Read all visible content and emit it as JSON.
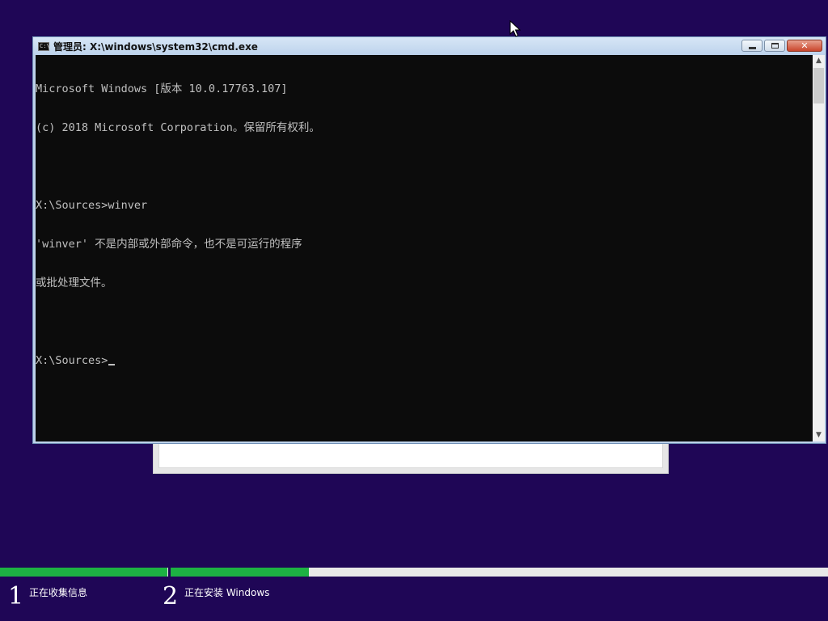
{
  "window": {
    "title": "管理员: X:\\windows\\system32\\cmd.exe",
    "icon": "console-icon",
    "icon_text": "C:\\",
    "buttons": [
      "minimize",
      "maximize",
      "close"
    ],
    "close_glyph": "✕"
  },
  "console": {
    "lines": [
      "Microsoft Windows [版本 10.0.17763.107]",
      "(c) 2018 Microsoft Corporation。保留所有权利。",
      "",
      "X:\\Sources>winver",
      "'winver' 不是内部或外部命令，也不是可运行的程序",
      "或批处理文件。",
      "",
      "X:\\Sources>"
    ],
    "text_color": "#c0c0c0",
    "background_color": "#0c0c0c"
  },
  "scrollbar": {
    "up_arrow": "▲",
    "down_arrow": "▼"
  },
  "setup": {
    "background_color": "#1f0656",
    "progress_color": "#1db143",
    "steps": [
      {
        "number": "1",
        "label": "正在收集信息",
        "progress": 1.0
      },
      {
        "number": "2",
        "label": "正在安装 Windows",
        "progress": 0.21
      }
    ]
  }
}
